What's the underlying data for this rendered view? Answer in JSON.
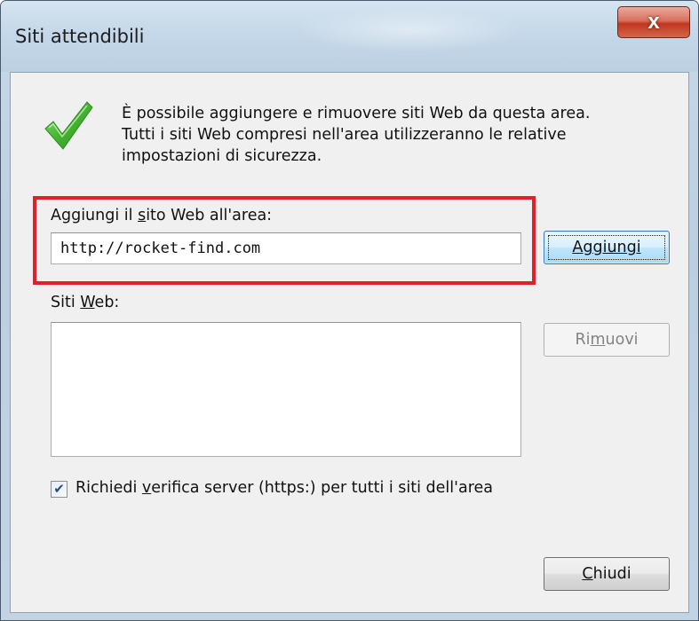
{
  "window": {
    "title": "Siti attendibili",
    "close_glyph": "x"
  },
  "info": {
    "icon": "checkmark-icon",
    "lines": [
      "È possibile aggiungere e rimuovere siti Web da questa area.",
      "Tutti i siti Web compresi nell'area utilizzeranno le relative",
      "impostazioni di sicurezza."
    ]
  },
  "add_site": {
    "label_before": "Aggiungi il ",
    "label_mnemonic": "s",
    "label_after": "ito Web all'area:",
    "value": "http://rocket-find.com",
    "button_label": "Aggiungi"
  },
  "sites": {
    "label_before": "Siti ",
    "label_mnemonic": "W",
    "label_after": "eb:",
    "items": [],
    "remove_before": "Ri",
    "remove_mnemonic": "m",
    "remove_after": "uovi"
  },
  "https": {
    "checked": true,
    "check_glyph": "✔",
    "label_before": "Richiedi ",
    "label_mnemonic": "v",
    "label_after": "erifica server (https:) per tutti i siti dell'area"
  },
  "close_button": {
    "mnemonic": "C",
    "label_after": "hiudi"
  },
  "colors": {
    "highlight": "#e2202a",
    "check_green": "#4cb83a"
  }
}
